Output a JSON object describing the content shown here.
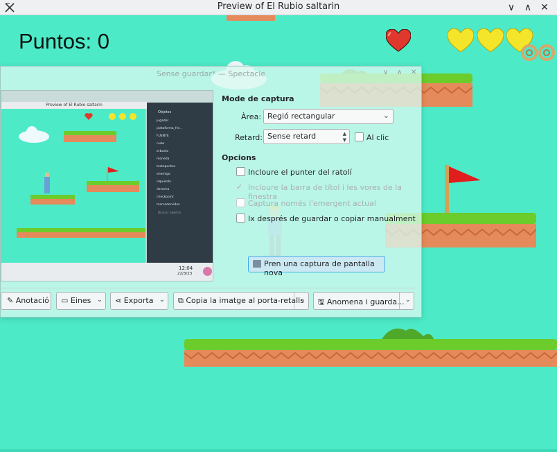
{
  "window": {
    "title": "Preview of El Rubio saltarin",
    "controls": [
      "∨",
      "∧",
      "✕"
    ]
  },
  "game": {
    "score_text": "Puntos: 0",
    "lives_full": 3
  },
  "spectacle": {
    "title": "Sense guardar* — Spectacle",
    "capture_mode_title": "Mode de captura",
    "area_label": "Àrea:",
    "area_value": "Regió rectangular",
    "delay_label": "Retard:",
    "delay_value": "Sense retard",
    "on_click_label": "Al clic",
    "options_title": "Opcions",
    "options": [
      {
        "label": "Incloure el punter del ratolí",
        "checked": false,
        "enabled": true
      },
      {
        "label": "Incloure la barra de títol i les vores de la finestra",
        "checked": true,
        "enabled": false
      },
      {
        "label": "Captura només l'emergent actual",
        "checked": false,
        "enabled": false
      },
      {
        "label": "Ix després de guardar o copiar manualment",
        "checked": false,
        "enabled": true
      }
    ],
    "new_capture_label": "Pren una captura de pantalla nova",
    "toolbar": {
      "annotate": "Anotació",
      "tools": "Eines",
      "export": "Exporta",
      "copy": "Copia la imatge al porta-retalls",
      "save_as": "Anomena i guarda..."
    }
  },
  "mini_preview": {
    "title": "Preview of El Rubio saltarin",
    "panel_title": "Objetos",
    "objects": [
      "jugador",
      "plataforma_fre...",
      "FUENTE",
      "nube",
      "arbusto",
      "moneda",
      "textopuntos",
      "enemigo",
      "izquierda",
      "derecha",
      "checkpoint",
      "marcadorvidas"
    ],
    "search_placeholder": "Buscar objetos",
    "clock_time": "12:04",
    "clock_date": "22/3/23"
  },
  "colors": {
    "sky": "#4deac8",
    "grass": "#6ccc2c",
    "dirt": "#e58a5a",
    "flag": "#e01e1e",
    "heart_red": "#e0382c",
    "heart_yellow": "#f5e52a",
    "accent": "#3daee9"
  }
}
